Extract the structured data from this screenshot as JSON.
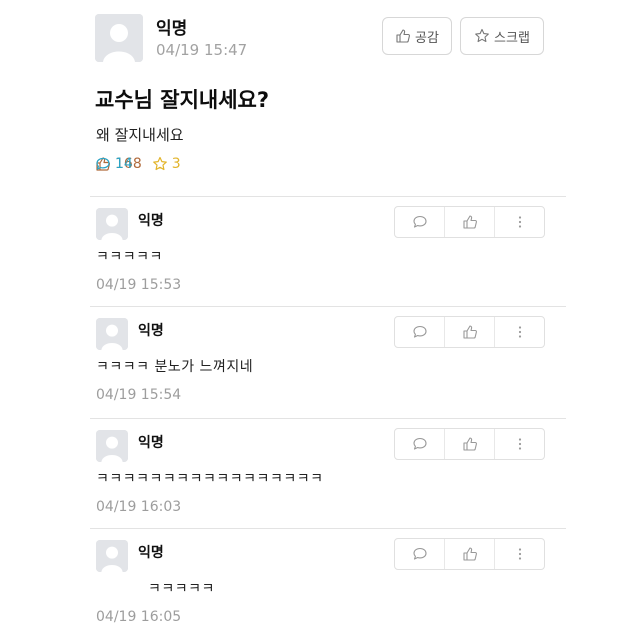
{
  "post": {
    "author": "익명",
    "time": "04/19 15:47",
    "like_button_label": "공감",
    "scrap_button_label": "스크랩",
    "title": "교수님 잘지내세요?",
    "body": "왜 잘지내세요",
    "likes": "168",
    "comments": "14",
    "scraps": "3"
  },
  "comments": [
    {
      "author": "익명",
      "text": "ㅋㅋㅋㅋㅋ",
      "time": "04/19 15:53"
    },
    {
      "author": "익명",
      "text": "ㅋㅋㅋㅋ 분노가 느껴지네",
      "time": "04/19 15:54"
    },
    {
      "author": "익명",
      "text": "ㅋㅋㅋㅋㅋㅋㅋㅋㅋㅋㅋㅋㅋㅋㅋㅋㅋ",
      "time": "04/19 16:03"
    },
    {
      "author": "익명",
      "text": "ㅋㅋㅋㅋㅋ",
      "time": "04/19 16:05"
    }
  ],
  "colors": {
    "like": "#b06a3b",
    "comment": "#2aa3c5",
    "scrap": "#e2b42a",
    "muted": "#9d9d9d"
  },
  "icons": {
    "avatar": "default-profile-icon",
    "like": "thumbs-up-icon",
    "comment": "speech-bubble-icon",
    "scrap": "star-icon",
    "more": "vertical-ellipsis-icon"
  }
}
